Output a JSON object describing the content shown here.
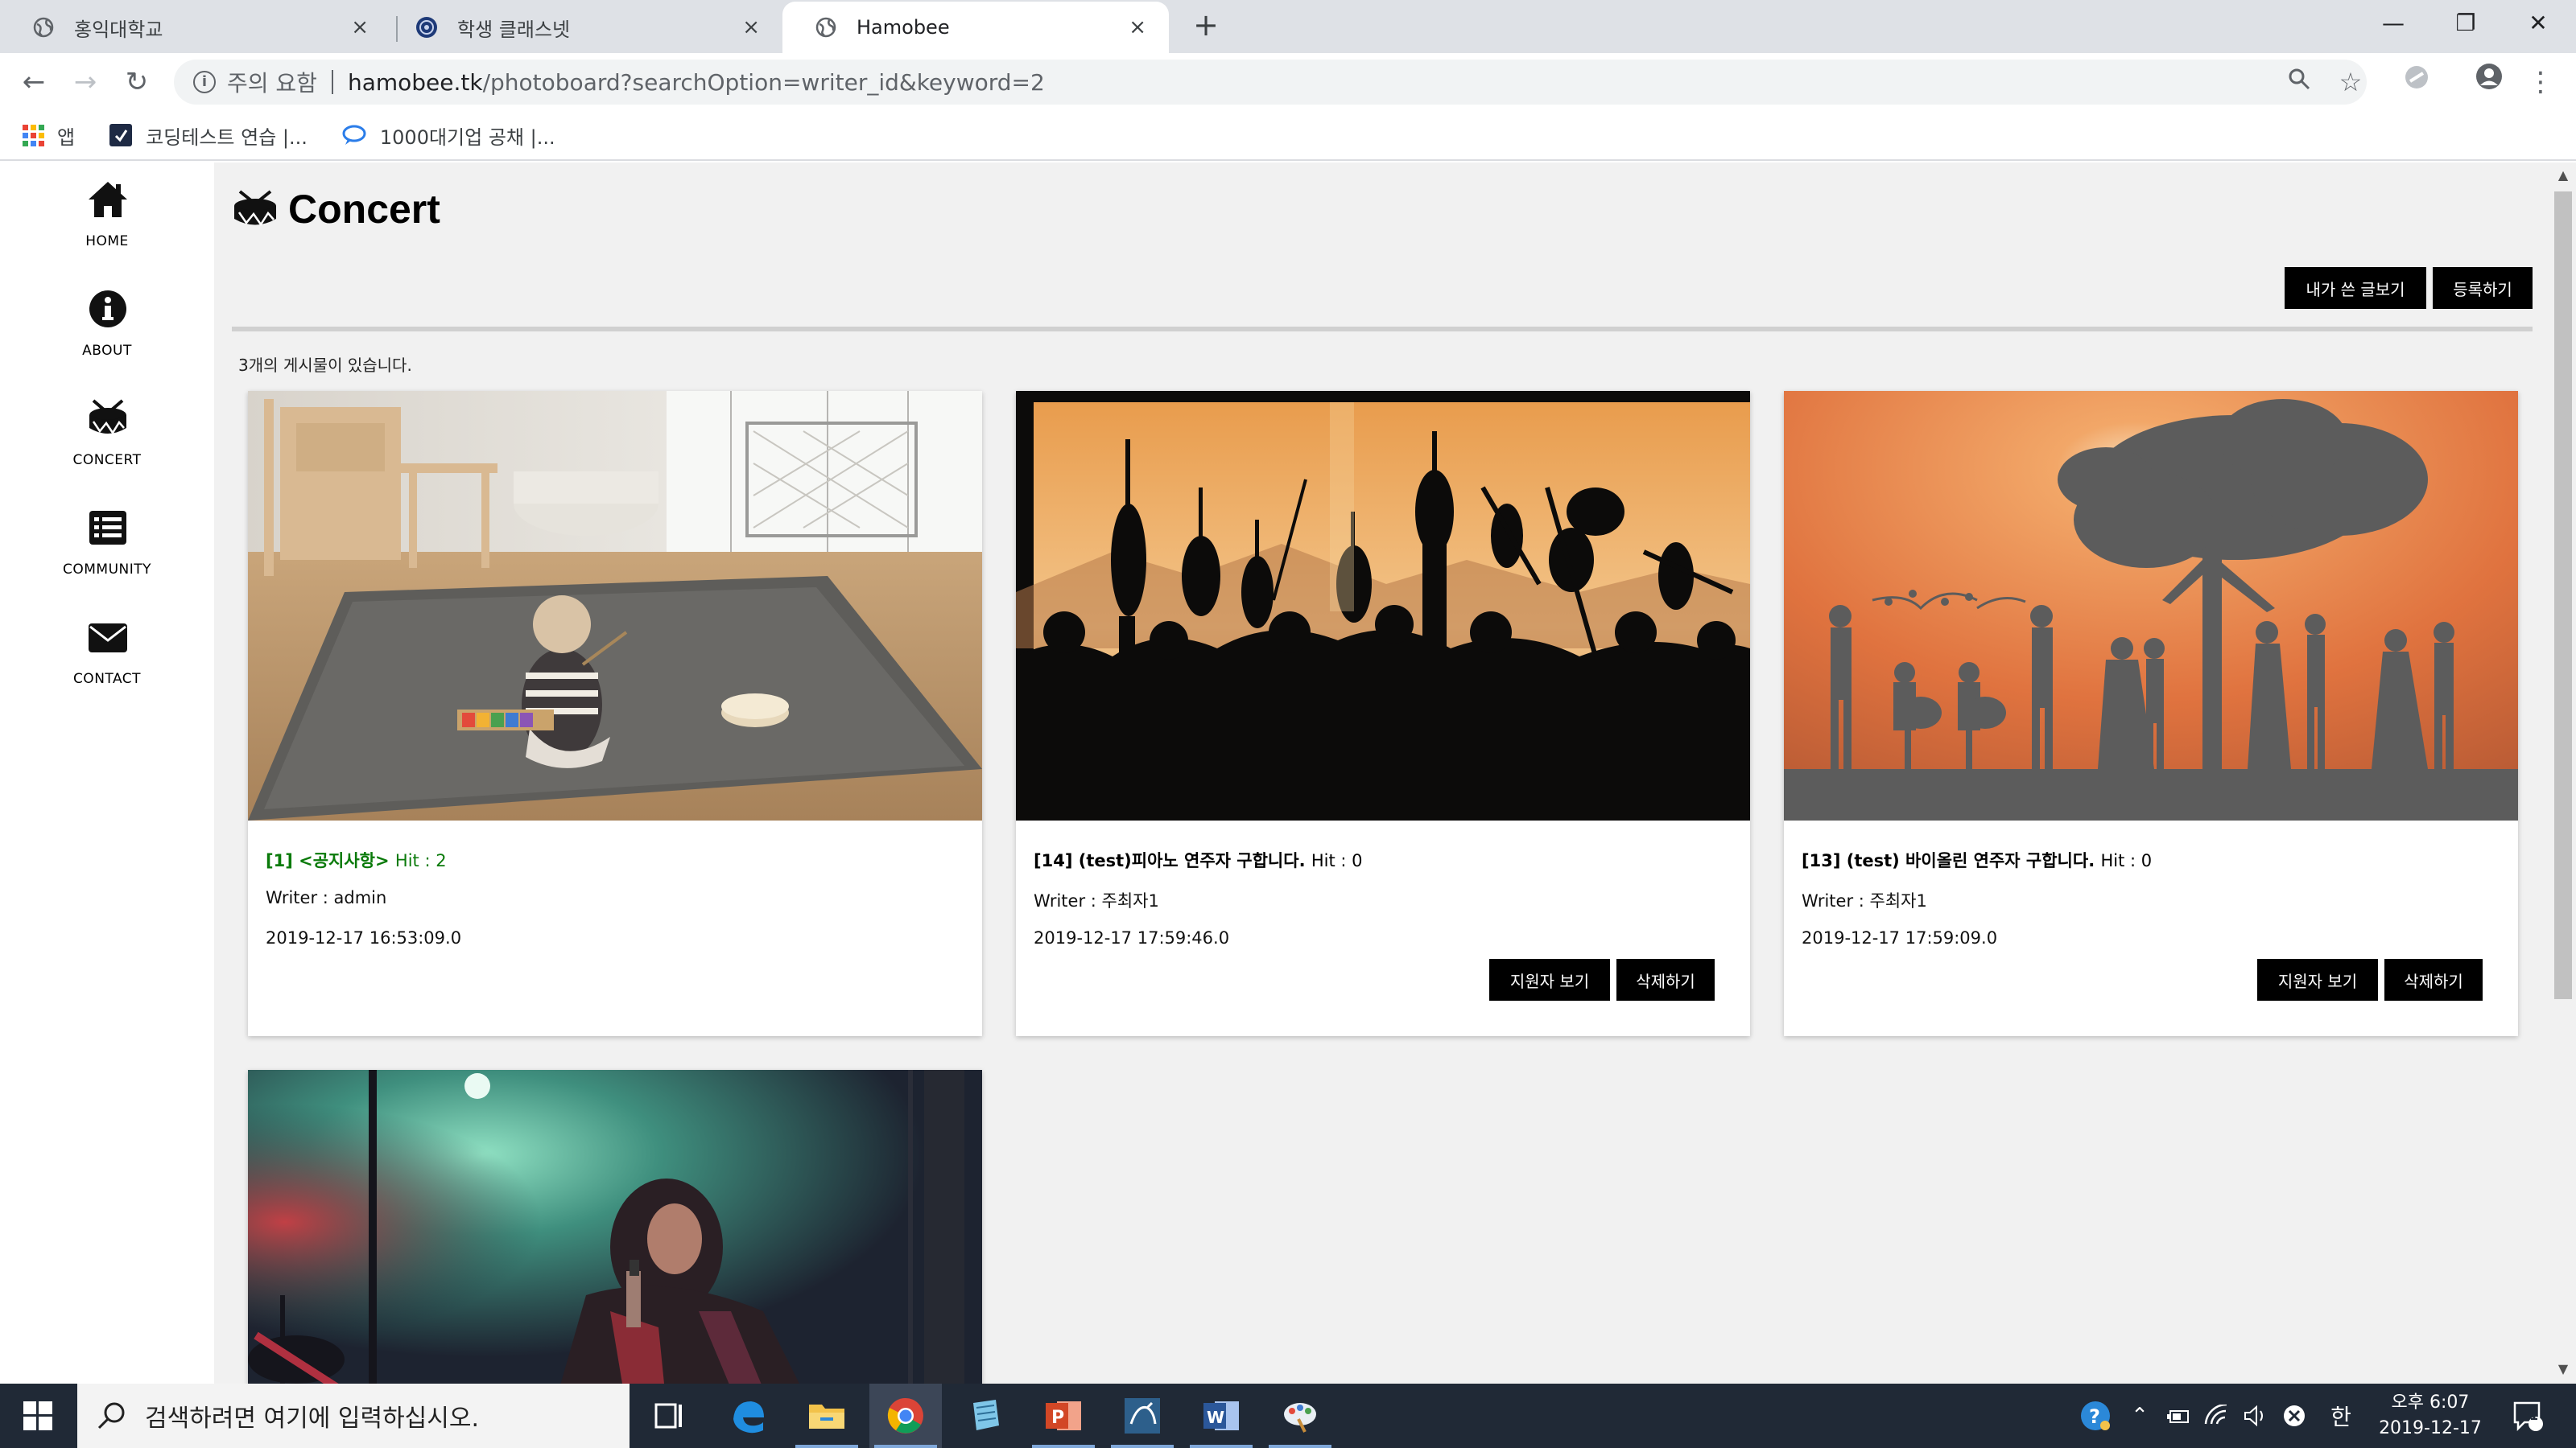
{
  "browser": {
    "tabs": [
      {
        "title": "홍익대학교",
        "close": "×"
      },
      {
        "title": "학생 클래스넷",
        "close": "×"
      },
      {
        "title": "Hamobee",
        "close": "×"
      }
    ],
    "new_tab": "+",
    "url_warning": "주의 요함",
    "url_host": "hamobee.tk",
    "url_path": "/photoboard?searchOption=writer_id&keyword=2",
    "bookmarks": [
      {
        "label": "앱",
        "icon": "apps-grid-icon"
      },
      {
        "label": "코딩테스트 연습 |...",
        "icon": "programmers-icon"
      },
      {
        "label": "1000대기업 공채 |...",
        "icon": "chat-bubble-icon"
      }
    ]
  },
  "sidebar": {
    "items": [
      {
        "label": "HOME",
        "icon": "home-icon"
      },
      {
        "label": "ABOUT",
        "icon": "info-icon"
      },
      {
        "label": "CONCERT",
        "icon": "drum-icon"
      },
      {
        "label": "COMMUNITY",
        "icon": "list-icon"
      },
      {
        "label": "CONTACT",
        "icon": "envelope-icon"
      }
    ]
  },
  "main": {
    "title": "Concert",
    "my_posts_button": "내가 쓴 글보기",
    "register_button": "등록하기",
    "post_count": "3개의 게시물이 있습니다.",
    "posts": [
      {
        "title": "[1] <공지사항>",
        "hit": "Hit : 2",
        "writer": "Writer : admin",
        "date": "2019-12-17 16:53:09.0",
        "notice": true
      },
      {
        "title": "[14] (test)피아노 연주자 구합니다.",
        "hit": "Hit : 0",
        "writer": "Writer : 주최자1",
        "date": "2019-12-17 17:59:46.0",
        "applicants_button": "지원자 보기",
        "delete_button": "삭제하기"
      },
      {
        "title": "[13] (test) 바이올린 연주자 구합니다.",
        "hit": "Hit : 0",
        "writer": "Writer : 주최자1",
        "date": "2019-12-17 17:59:09.0",
        "applicants_button": "지원자 보기",
        "delete_button": "삭제하기"
      }
    ]
  },
  "taskbar": {
    "search_placeholder": "검색하려면 여기에 입력하십시오.",
    "apps": [
      "task-view-icon",
      "edge-icon",
      "file-explorer-icon",
      "chrome-icon",
      "notepad-icon",
      "powerpoint-icon",
      "mysql-workbench-icon",
      "word-icon",
      "paint-icon"
    ],
    "ime": "한",
    "time": "오후 6:07",
    "date": "2019-12-17",
    "notification_count": "1"
  },
  "colors": {
    "notice_green": "#0a7a0a",
    "button_black": "#000000",
    "page_bg": "#f1f1f1",
    "taskbar_bg": "#202936"
  }
}
